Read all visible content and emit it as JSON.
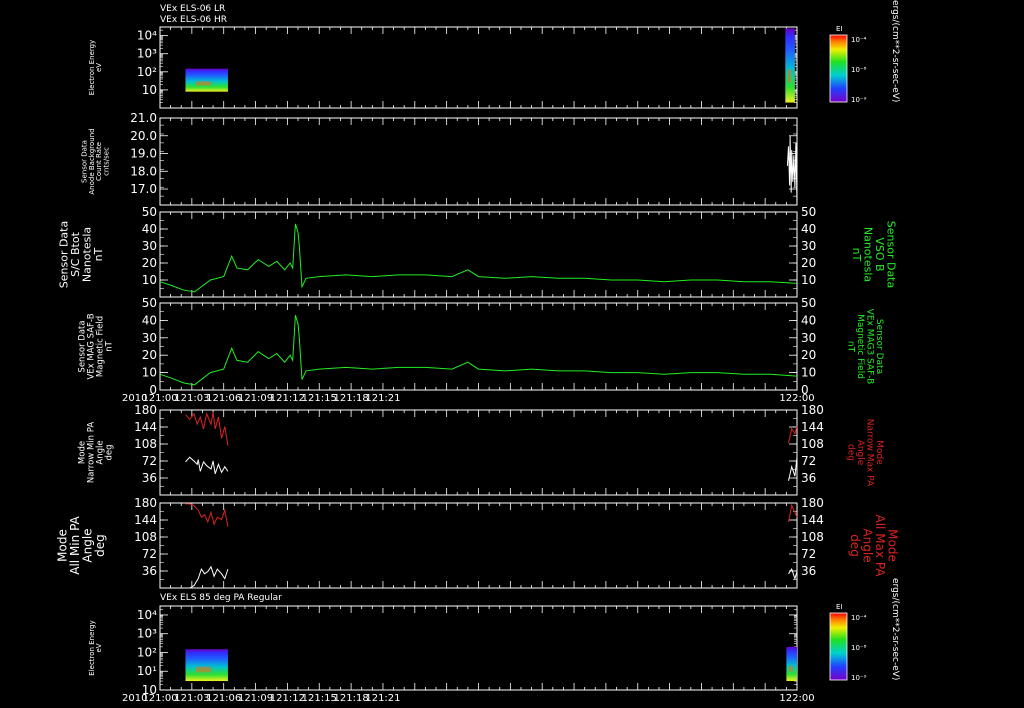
{
  "header": {
    "line1": "VEx ELS-06 LR",
    "line2": "VEx ELS-06 HR"
  },
  "x_axis": {
    "ticks": [
      "121:00",
      "121:03",
      "121:06",
      "121:09",
      "121:12",
      "121:15",
      "121:18",
      "121:21",
      "122:00"
    ],
    "year": "2010"
  },
  "colorbar": {
    "title": "EI",
    "ticks": [
      "10⁻⁴",
      "10⁻⁸",
      "10⁻⁹"
    ],
    "units": "ergs/(cm**2-sr-sec-eV)"
  },
  "panels": {
    "p1": {
      "left_label": [
        "Electron Energy",
        "eV"
      ]
    },
    "p2": {
      "left_label": [
        "Sensor Data",
        "Anode Background",
        "Count Rate",
        "cnts/sec"
      ]
    },
    "p3": {
      "left_label": [
        "Sensor Data",
        "S/C Btot",
        "Nanotesla",
        "nT"
      ],
      "right_label": [
        "Sensor Data",
        "VSO B",
        "Nanotesla",
        "nT"
      ]
    },
    "p4": {
      "left_label": [
        "Sensor Data",
        "VEx MAG SAF-B",
        "Magnetic Field",
        "nT"
      ],
      "right_label": [
        "Sensor Data",
        "VEx MAG3 SAF-B",
        "Magnetic Field",
        "nT"
      ]
    },
    "p5": {
      "left_label": [
        "Mode",
        "Narrow Min PA",
        "Angle",
        "deg"
      ],
      "right_label": [
        "Mode",
        "Narrow Max PA",
        "Angle",
        "deg"
      ]
    },
    "p6": {
      "left_label": [
        "Mode",
        "All Min PA",
        "Angle",
        "deg"
      ],
      "right_label": [
        "Mode",
        "All Max PA",
        "Angle",
        "deg"
      ]
    },
    "p7": {
      "title": "VEx ELS 85 deg PA Regular",
      "left_label": [
        "Electron Energy",
        "eV"
      ]
    }
  },
  "colors": {
    "magnetic": "#22ee22",
    "max_pa": "#dd2222",
    "min_pa": "#ffffff",
    "axes": "#ffffff"
  },
  "chart_data": [
    {
      "type": "heatmap",
      "name": "VEx ELS-06 LR / HR",
      "ylabel": "Electron Energy eV",
      "yscale": "log",
      "ylim": [
        1,
        30000
      ],
      "y_ticks": [
        {
          "v": 10,
          "l": "10"
        },
        {
          "v": 100,
          "l": "10²"
        },
        {
          "v": 1000,
          "l": "10³"
        },
        {
          "v": 10000,
          "l": "10⁴"
        }
      ],
      "blocks": [
        {
          "t": [
            2.4,
            6.4
          ],
          "e": [
            8,
            150
          ]
        },
        {
          "t": [
            58.9,
            59.8
          ],
          "e": [
            2,
            25000
          ]
        }
      ]
    },
    {
      "type": "line",
      "name": "Anode Background",
      "ylabel": "Sensor Data Anode Background Count Rate cnts/sec",
      "ylim": [
        16.1,
        21.0
      ],
      "y_ticks": [
        17.0,
        18.0,
        19.0,
        20.0,
        21.0
      ],
      "y_tick_labels": [
        "17.0",
        "18.0",
        "19.0",
        "20.0",
        "21.0"
      ],
      "t": [
        59.1,
        59.2,
        59.3,
        59.35,
        59.45,
        59.5,
        59.6,
        59.7,
        59.8,
        59.9,
        60
      ],
      "values": [
        18.3,
        19.4,
        17.2,
        20.0,
        16.8,
        19.2,
        17.4,
        18.9,
        17.1,
        19.6,
        16.2
      ]
    },
    {
      "type": "line",
      "name": "S/C Btot",
      "ylabel": "nT",
      "ylim": [
        0,
        50
      ],
      "y_ticks": [
        10,
        20,
        30,
        40,
        50
      ],
      "t": [
        0.0,
        0.4,
        0.9,
        1.3,
        1.9,
        2.4,
        2.7,
        2.9,
        3.3,
        3.7,
        4.1,
        4.4,
        4.7,
        4.9,
        5.0,
        5.1,
        5.2,
        5.25,
        5.35,
        5.5,
        6.0,
        7.0,
        8.0,
        9.0,
        10.0,
        11.0,
        11.6,
        12.0,
        13.0,
        14.0,
        15.0,
        16.0,
        17.0,
        18.0,
        19.0,
        20.0,
        21.0,
        22.0,
        23.0,
        24.0
      ],
      "values": [
        9,
        7,
        4,
        3,
        10,
        12,
        24,
        17,
        16,
        22,
        18,
        21,
        16,
        20,
        17,
        43,
        38,
        30,
        6,
        11,
        12,
        13,
        12,
        13,
        13,
        12,
        16,
        12,
        11,
        12,
        11,
        11,
        10,
        10,
        9,
        10,
        10,
        9,
        9,
        8
      ]
    },
    {
      "type": "line",
      "name": "VEx MAG SAF-B",
      "ylabel": "nT",
      "ylim": [
        0,
        50
      ],
      "y_ticks": [
        0,
        10,
        20,
        30,
        40,
        50
      ],
      "t": [
        0.0,
        0.4,
        0.9,
        1.3,
        1.9,
        2.4,
        2.7,
        2.9,
        3.3,
        3.7,
        4.1,
        4.4,
        4.7,
        4.9,
        5.0,
        5.1,
        5.2,
        5.25,
        5.35,
        5.5,
        6.0,
        7.0,
        8.0,
        9.0,
        10.0,
        11.0,
        11.6,
        12.0,
        13.0,
        14.0,
        15.0,
        16.0,
        17.0,
        18.0,
        19.0,
        20.0,
        21.0,
        22.0,
        23.0,
        24.0
      ],
      "values": [
        9,
        7,
        4,
        3,
        10,
        12,
        24,
        17,
        16,
        22,
        18,
        21,
        16,
        20,
        17,
        43,
        38,
        30,
        6,
        11,
        12,
        13,
        12,
        13,
        13,
        12,
        16,
        12,
        11,
        12,
        11,
        11,
        10,
        10,
        9,
        10,
        10,
        9,
        9,
        8
      ]
    },
    {
      "type": "line",
      "name": "Narrow Min/Max PA",
      "ylabel": "deg",
      "ylim": [
        0,
        180
      ],
      "y_ticks": [
        36,
        72,
        108,
        144,
        180
      ],
      "series": [
        {
          "role": "max",
          "t": [
            2.4,
            2.8,
            3.2,
            3.5,
            3.6,
            3.8,
            4.1,
            4.4,
            4.8,
            5.0,
            5.2,
            5.5,
            5.8,
            6.1,
            6.4
          ],
          "values": [
            170,
            160,
            172,
            150,
            155,
            165,
            140,
            172,
            150,
            175,
            140,
            165,
            120,
            145,
            105
          ]
        },
        {
          "role": "min",
          "t": [
            2.4,
            2.8,
            3.2,
            3.5,
            3.6,
            3.8,
            4.1,
            4.4,
            4.8,
            5.0,
            5.2,
            5.5,
            5.8,
            6.1,
            6.4
          ],
          "values": [
            70,
            80,
            72,
            65,
            75,
            50,
            70,
            62,
            55,
            72,
            45,
            65,
            48,
            60,
            50
          ]
        },
        {
          "role": "max",
          "t": [
            59.2,
            59.5,
            59.8,
            60
          ],
          "values": [
            110,
            140,
            130,
            145
          ]
        },
        {
          "role": "min",
          "t": [
            59.2,
            59.5,
            59.8,
            60
          ],
          "values": [
            30,
            60,
            40,
            80
          ]
        }
      ]
    },
    {
      "type": "line",
      "name": "All Min/Max PA",
      "ylabel": "deg",
      "ylim": [
        0,
        180
      ],
      "y_ticks": [
        36,
        72,
        108,
        144,
        180
      ],
      "series": [
        {
          "role": "max",
          "t": [
            2.4,
            2.8,
            3.2,
            3.6,
            3.9,
            4.2,
            4.5,
            4.8,
            5.1,
            5.4,
            5.8,
            6.1,
            6.4
          ],
          "values": [
            178,
            178,
            175,
            165,
            150,
            155,
            140,
            160,
            135,
            150,
            145,
            165,
            130
          ]
        },
        {
          "role": "min",
          "t": [
            2.4,
            2.8,
            3.2,
            3.6,
            3.9,
            4.2,
            4.5,
            4.8,
            5.1,
            5.4,
            5.8,
            6.1,
            6.4
          ],
          "values": [
            0,
            0,
            5,
            20,
            40,
            30,
            35,
            45,
            25,
            40,
            30,
            20,
            40
          ]
        },
        {
          "role": "max",
          "t": [
            59.2,
            59.5,
            59.8,
            60
          ],
          "values": [
            140,
            175,
            160,
            150
          ]
        },
        {
          "role": "min",
          "t": [
            59.2,
            59.5,
            59.8,
            60
          ],
          "values": [
            30,
            40,
            20,
            35
          ]
        }
      ]
    },
    {
      "type": "heatmap",
      "name": "VEx ELS 85 deg PA Regular",
      "ylabel": "Electron Energy eV",
      "yscale": "log",
      "ylim": [
        1,
        30000
      ],
      "y_ticks": [
        {
          "v": 1,
          "l": "10"
        },
        {
          "v": 10,
          "l": "10¹"
        },
        {
          "v": 100,
          "l": "10²"
        },
        {
          "v": 1000,
          "l": "10³"
        },
        {
          "v": 10000,
          "l": "10⁴"
        }
      ],
      "blocks": [
        {
          "t": [
            2.4,
            6.4
          ],
          "e": [
            3,
            150
          ]
        },
        {
          "t": [
            59.0,
            60.0
          ],
          "e": [
            3,
            200
          ]
        }
      ]
    }
  ]
}
